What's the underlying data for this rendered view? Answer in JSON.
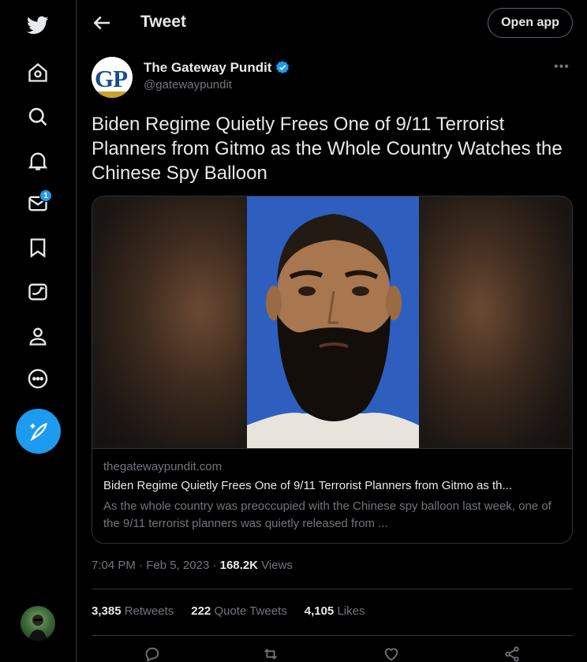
{
  "header": {
    "title": "Tweet",
    "open_app_label": "Open app"
  },
  "sidebar": {
    "icons": [
      "twitter-logo",
      "home-icon",
      "search-icon",
      "notifications-icon",
      "messages-icon",
      "bookmark-icon",
      "twitter-blue-icon",
      "profile-icon",
      "more-icon",
      "compose-icon"
    ],
    "messages_badge": "1"
  },
  "author": {
    "avatar_text": "GP",
    "name": "The Gateway Pundit",
    "handle": "@gatewaypundit"
  },
  "tweet": {
    "text": "Biden Regime Quietly Frees One of  9/11 Terrorist Planners from Gitmo as the Whole Country Watches the Chinese Spy Balloon"
  },
  "card": {
    "domain": "thegatewaypundit.com",
    "title": "Biden Regime Quietly Frees One of 9/11 Terrorist Planners from Gitmo as th...",
    "description": "As the whole country was preoccupied with the Chinese spy balloon last week, one of the 9/11 terrorist planners was quietly released from ..."
  },
  "meta": {
    "time": "7:04 PM",
    "separator": "·",
    "date": "Feb 5, 2023",
    "views_count": "168.2K",
    "views_label": "Views"
  },
  "stats": {
    "retweets_count": "3,385",
    "retweets_label": "Retweets",
    "quotes_count": "222",
    "quotes_label": "Quote Tweets",
    "likes_count": "4,105",
    "likes_label": "Likes"
  },
  "colors": {
    "accent": "#1d9bf0",
    "background": "#000000",
    "text": "#e7e9ea",
    "muted": "#71767b",
    "border": "#2f3336"
  }
}
